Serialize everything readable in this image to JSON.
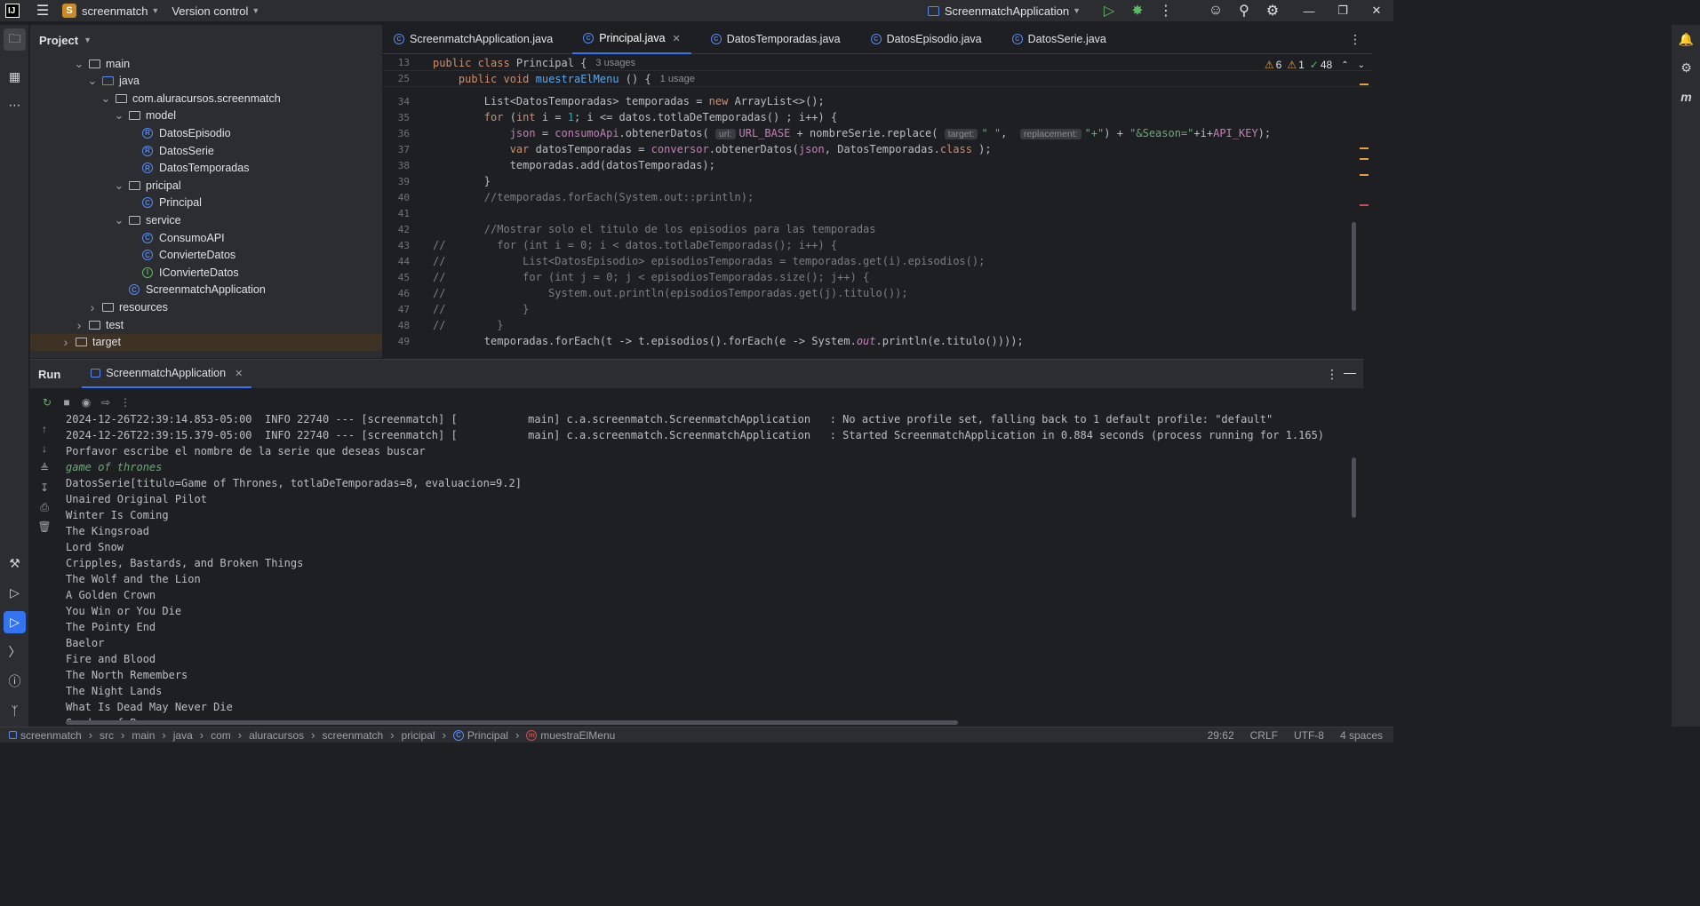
{
  "titlebar": {
    "project_badge": "S",
    "project_name": "screenmatch",
    "vcs": "Version control",
    "run_config": "ScreenmatchApplication"
  },
  "project": {
    "title": "Project",
    "tree": [
      {
        "label": "main",
        "indent": 3,
        "arrow": "down",
        "icon": "folder"
      },
      {
        "label": "java",
        "indent": 4,
        "arrow": "down",
        "icon": "folder-blue"
      },
      {
        "label": "com.aluracursos.screenmatch",
        "indent": 5,
        "arrow": "down",
        "icon": "package"
      },
      {
        "label": "model",
        "indent": 6,
        "arrow": "down",
        "icon": "package"
      },
      {
        "label": "DatosEpisodio",
        "indent": 7,
        "arrow": "",
        "icon": "record"
      },
      {
        "label": "DatosSerie",
        "indent": 7,
        "arrow": "",
        "icon": "record"
      },
      {
        "label": "DatosTemporadas",
        "indent": 7,
        "arrow": "",
        "icon": "record"
      },
      {
        "label": "pricipal",
        "indent": 6,
        "arrow": "down",
        "icon": "package"
      },
      {
        "label": "Principal",
        "indent": 7,
        "arrow": "",
        "icon": "class"
      },
      {
        "label": "service",
        "indent": 6,
        "arrow": "down",
        "icon": "package"
      },
      {
        "label": "ConsumoAPI",
        "indent": 7,
        "arrow": "",
        "icon": "class"
      },
      {
        "label": "ConvierteDatos",
        "indent": 7,
        "arrow": "",
        "icon": "class"
      },
      {
        "label": "IConvierteDatos",
        "indent": 7,
        "arrow": "",
        "icon": "interface"
      },
      {
        "label": "ScreenmatchApplication",
        "indent": 6,
        "arrow": "",
        "icon": "spring"
      },
      {
        "label": "resources",
        "indent": 4,
        "arrow": "right",
        "icon": "folder"
      },
      {
        "label": "test",
        "indent": 3,
        "arrow": "right",
        "icon": "folder"
      },
      {
        "label": "target",
        "indent": 2,
        "arrow": "right",
        "icon": "folder"
      }
    ]
  },
  "editor": {
    "tabs": [
      {
        "label": "ScreenmatchApplication.java",
        "active": false
      },
      {
        "label": "Principal.java",
        "active": true
      },
      {
        "label": "DatosTemporadas.java",
        "active": false
      },
      {
        "label": "DatosEpisodio.java",
        "active": false
      },
      {
        "label": "DatosSerie.java",
        "active": false
      }
    ],
    "inspections": {
      "warnings": "6",
      "weak_warnings": "1",
      "ok": "48"
    },
    "sticky": [
      {
        "ln": "13",
        "html": "<span class=\"kw\">public class</span> Principal {",
        "usages": "3 usages"
      },
      {
        "ln": "25",
        "html": "    <span class=\"kw\">public void</span> <span style=\"color:#56a8f5\">muestraElMenu</span> () {",
        "usages": "1 usage"
      }
    ],
    "lines": [
      {
        "ln": "34",
        "html": "        List&lt;DatosTemporadas&gt; temporadas = <span class=\"kw\">new</span> ArrayList&lt;&gt;();"
      },
      {
        "ln": "35",
        "html": "        <span class=\"kw\">for</span> (<span class=\"kw\">int</span> i = <span class=\"num\">1</span>; i &lt;= datos.totlaDeTemporadas() ; i++) {"
      },
      {
        "ln": "36",
        "html": "            <span class=\"fld\">json</span> = <span class=\"fld\">consumoApi</span>.obtenerDatos( <span class=\"hint\">url:</span><span class=\"fld\">URL_BASE</span> + nombreSerie.replace( <span class=\"hint\">target:</span><span class=\"str\">\" \"</span>,  <span class=\"hint\">replacement:</span><span class=\"str\">\"+\"</span>) + <span class=\"str\">\"&amp;Season=\"</span>+i+<span class=\"fld\">API_KEY</span>);"
      },
      {
        "ln": "37",
        "html": "            <span class=\"kw\">var</span> datosTemporadas = <span class=\"fld\">conversor</span>.obtenerDatos(<span class=\"fld\">json</span>, DatosTemporadas.<span class=\"kw\">class</span> );"
      },
      {
        "ln": "38",
        "html": "            temporadas.add(datosTemporadas);"
      },
      {
        "ln": "39",
        "html": "        }"
      },
      {
        "ln": "40",
        "html": "        <span class=\"cmt\">//temporadas.forEach(System.out::println);</span>"
      },
      {
        "ln": "41",
        "html": ""
      },
      {
        "ln": "42",
        "html": "        <span class=\"cmt\">//Mostrar solo el titulo de los episodios para las temporadas</span>"
      },
      {
        "ln": "43",
        "html": "<span class=\"cmt\">//        for (int i = 0; i &lt; datos.totlaDeTemporadas(); i++) {</span>"
      },
      {
        "ln": "44",
        "html": "<span class=\"cmt\">//            List&lt;DatosEpisodio&gt; episodiosTemporadas = temporadas.get(i).episodios();</span>"
      },
      {
        "ln": "45",
        "html": "<span class=\"cmt\">//            for (int j = 0; j &lt; episodiosTemporadas.size(); j++) {</span>"
      },
      {
        "ln": "46",
        "html": "<span class=\"cmt\">//                System.out.println(episodiosTemporadas.get(j).titulo());</span>"
      },
      {
        "ln": "47",
        "html": "<span class=\"cmt\">//            }</span>"
      },
      {
        "ln": "48",
        "html": "<span class=\"cmt\">//        }</span>"
      },
      {
        "ln": "49",
        "html": "        temporadas.forEach(t -&gt; t.episodios().forEach(e -&gt; System.<span class=\"fld\"><i>out</i></span>.println(e.titulo())));"
      }
    ]
  },
  "run": {
    "title": "Run",
    "tab": "ScreenmatchApplication",
    "console": [
      {
        "text": "2024-12-26T22:39:14.853-05:00  INFO 22740 --- [screenmatch] [           main] c.a.screenmatch.ScreenmatchApplication   : No active profile set, falling back to 1 default profile: \"default\"",
        "input": false
      },
      {
        "text": "2024-12-26T22:39:15.379-05:00  INFO 22740 --- [screenmatch] [           main] c.a.screenmatch.ScreenmatchApplication   : Started ScreenmatchApplication in 0.884 seconds (process running for 1.165)",
        "input": false
      },
      {
        "text": "Porfavor escribe el nombre de la serie que deseas buscar",
        "input": false
      },
      {
        "text": "game of thrones",
        "input": true
      },
      {
        "text": "DatosSerie[titulo=Game of Thrones, totlaDeTemporadas=8, evaluacion=9.2]",
        "input": false
      },
      {
        "text": "Unaired Original Pilot",
        "input": false
      },
      {
        "text": "Winter Is Coming",
        "input": false
      },
      {
        "text": "The Kingsroad",
        "input": false
      },
      {
        "text": "Lord Snow",
        "input": false
      },
      {
        "text": "Cripples, Bastards, and Broken Things",
        "input": false
      },
      {
        "text": "The Wolf and the Lion",
        "input": false
      },
      {
        "text": "A Golden Crown",
        "input": false
      },
      {
        "text": "You Win or You Die",
        "input": false
      },
      {
        "text": "The Pointy End",
        "input": false
      },
      {
        "text": "Baelor",
        "input": false
      },
      {
        "text": "Fire and Blood",
        "input": false
      },
      {
        "text": "The North Remembers",
        "input": false
      },
      {
        "text": "The Night Lands",
        "input": false
      },
      {
        "text": "What Is Dead May Never Die",
        "input": false
      },
      {
        "text": "Garden of Bones",
        "input": false
      }
    ]
  },
  "statusbar": {
    "crumbs": [
      "screenmatch",
      "src",
      "main",
      "java",
      "com",
      "aluracursos",
      "screenmatch",
      "pricipal",
      "Principal",
      "muestraElMenu"
    ],
    "position": "29:62",
    "line_sep": "CRLF",
    "encoding": "UTF-8",
    "indent": "4 spaces"
  }
}
